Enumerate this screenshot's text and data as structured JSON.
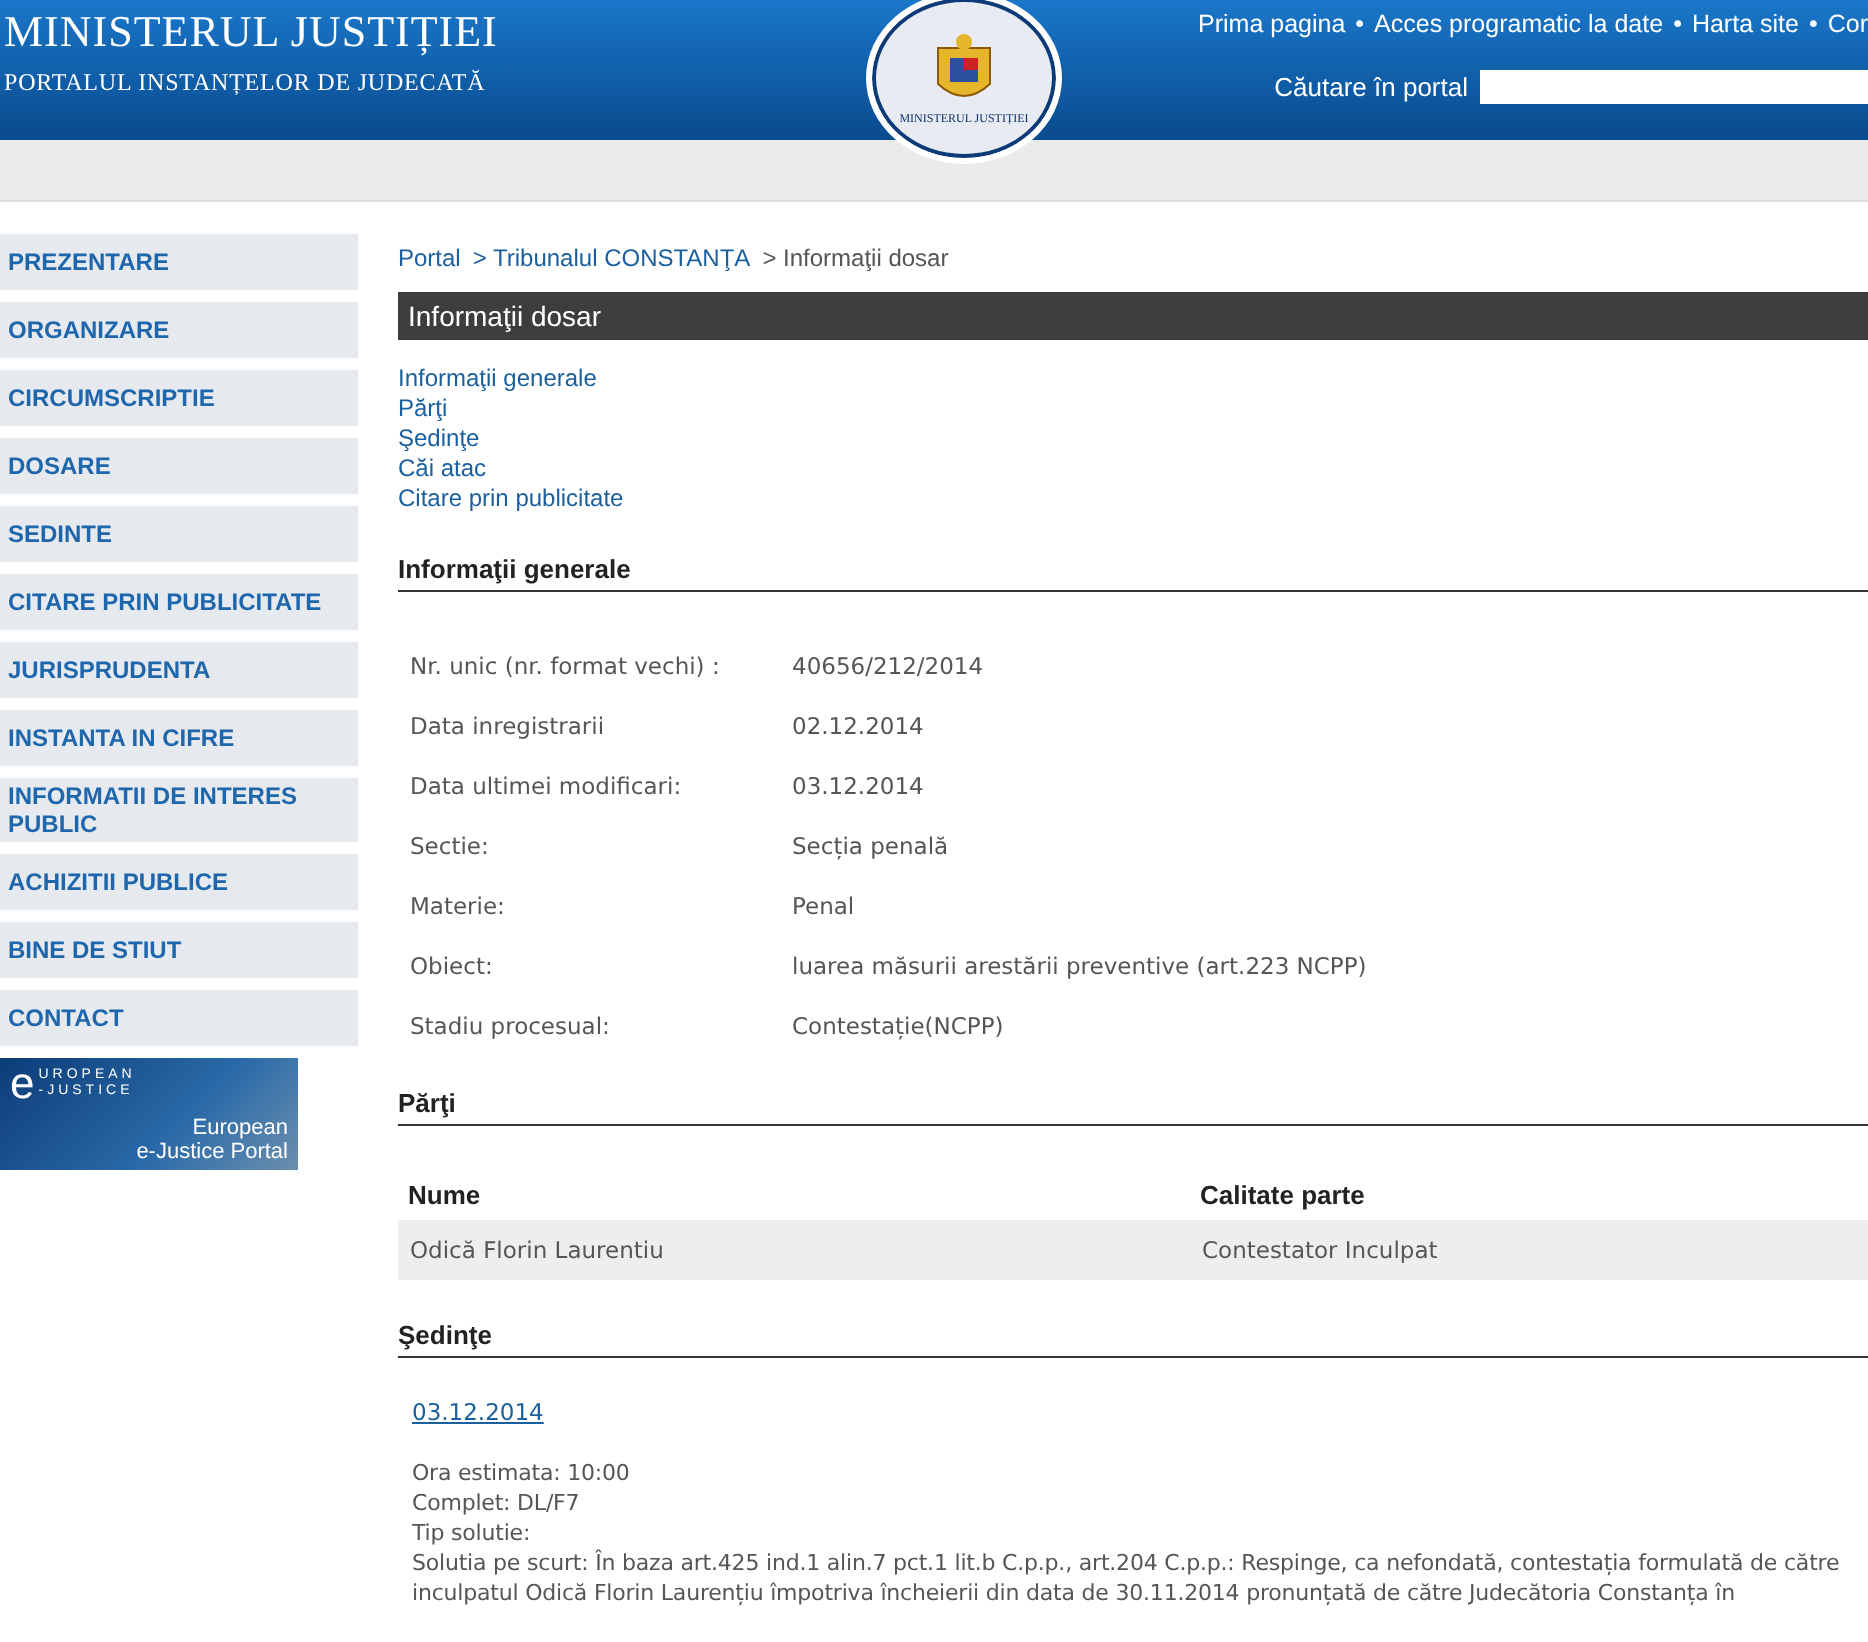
{
  "header": {
    "title": "MINISTERUL JUSTIȚIEI",
    "subtitle": "PORTALUL INSTANȚELOR DE JUDECATĂ",
    "emblem_text": "MINISTERUL JUSTIȚIEI",
    "nav": [
      "Prima pagina",
      "Acces programatic la date",
      "Harta site",
      "Cor"
    ],
    "nav_separator": "•",
    "search": {
      "label": "Căutare în portal"
    }
  },
  "sidebar": {
    "items": [
      {
        "label": "PREZENTARE"
      },
      {
        "label": "ORGANIZARE"
      },
      {
        "label": "CIRCUMSCRIPTIE"
      },
      {
        "label": "DOSARE"
      },
      {
        "label": "SEDINTE"
      },
      {
        "label": "CITARE PRIN PUBLICITATE"
      },
      {
        "label": "JURISPRUDENTA"
      },
      {
        "label": "INSTANTA IN CIFRE"
      },
      {
        "label": "INFORMATII DE INTERES PUBLIC"
      },
      {
        "label": "ACHIZITII PUBLICE"
      },
      {
        "label": "BINE DE STIUT"
      },
      {
        "label": "CONTACT"
      }
    ],
    "banner": {
      "mark": "e",
      "line1": "UROPEAN",
      "line2": "-JUSTICE",
      "caption": [
        "European",
        "e-Justice Portal"
      ]
    }
  },
  "breadcrumb": [
    {
      "label": "Portal",
      "link": true
    },
    {
      "label": "> Tribunalul CONSTANŢA",
      "link": true
    },
    {
      "label": "> Informaţii dosar",
      "link": false
    }
  ],
  "page_title": "Informaţii dosar",
  "anchors": [
    "Informaţii generale",
    "Părţi",
    "Şedinţe",
    "Căi atac",
    "Citare prin publicitate"
  ],
  "general": {
    "heading": "Informaţii generale",
    "rows": [
      {
        "label": "Nr. unic (nr. format vechi) :",
        "value": "40656/212/2014"
      },
      {
        "label": "Data inregistrarii",
        "value": "02.12.2014"
      },
      {
        "label": "Data ultimei modificari:",
        "value": "03.12.2014"
      },
      {
        "label": "Sectie:",
        "value": "Secția penală"
      },
      {
        "label": "Materie:",
        "value": "Penal"
      },
      {
        "label": "Obiect:",
        "value": "luarea măsurii arestării preventive (art.223 NCPP)"
      },
      {
        "label": "Stadiu procesual:",
        "value": "Contestație(NCPP)"
      }
    ]
  },
  "parties": {
    "heading": "Părţi",
    "columns": [
      "Nume",
      "Calitate parte"
    ],
    "rows": [
      [
        "Odică Florin Laurentiu",
        "Contestator Inculpat"
      ]
    ]
  },
  "hearings": {
    "heading": "Şedinţe",
    "items": [
      {
        "date": "03.12.2014",
        "lines": [
          "Ora estimata: 10:00",
          "Complet: DL/F7",
          "Tip solutie:"
        ],
        "summary": "Solutia pe scurt: În baza art.425 ind.1 alin.7 pct.1 lit.b C.p.p., art.204 C.p.p.: Respinge, ca nefondată, contestația formulată de către inculpatul Odică Florin Laurențiu împotriva încheierii din data de 30.11.2014 pronunțată de către Judecătoria Constanța în"
      }
    ]
  }
}
